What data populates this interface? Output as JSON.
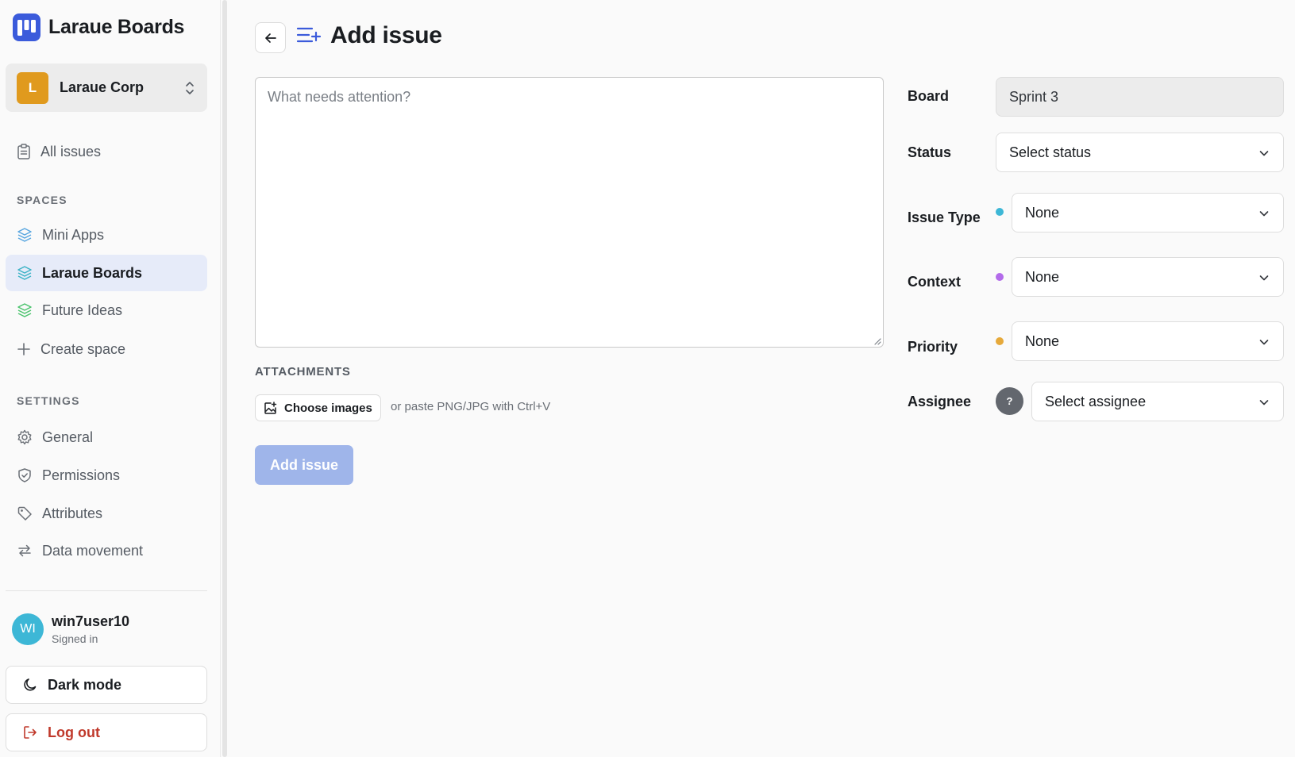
{
  "brand": {
    "title": "Laraue Boards",
    "color": "#3b5bdb"
  },
  "org": {
    "initial": "L",
    "name": "Laraue Corp",
    "color": "#e09a1e"
  },
  "nav": {
    "all_issues": "All issues"
  },
  "spaces": {
    "label": "SPACES",
    "items": [
      {
        "label": "Mini Apps",
        "icon": "layers-icon",
        "color": "#5aa7e0"
      },
      {
        "label": "Laraue Boards",
        "icon": "layers-icon",
        "color": "#3cb3c6",
        "active": true
      },
      {
        "label": "Future Ideas",
        "icon": "layers-icon",
        "color": "#4cc46e"
      }
    ],
    "create_label": "Create space"
  },
  "settings": {
    "label": "SETTINGS",
    "items": [
      {
        "label": "General",
        "icon": "gear-icon"
      },
      {
        "label": "Permissions",
        "icon": "shield-icon"
      },
      {
        "label": "Attributes",
        "icon": "tag-icon"
      },
      {
        "label": "Data movement",
        "icon": "arrows-swap-icon"
      }
    ]
  },
  "user": {
    "initials": "WI",
    "name": "win7user10",
    "status": "Signed in",
    "color": "#3db7d6"
  },
  "sidebar_actions": {
    "dark_mode": "Dark mode",
    "log_out": "Log out"
  },
  "page": {
    "title": "Add issue"
  },
  "form": {
    "description_placeholder": "What needs attention?",
    "description_value": "",
    "attachments_label": "ATTACHMENTS",
    "choose_images": "Choose images",
    "paste_hint": "or paste PNG/JPG with Ctrl+V",
    "submit": "Add issue",
    "submit_color": "#9fb5ea"
  },
  "fields": {
    "board": {
      "label": "Board",
      "value": "Sprint 3"
    },
    "status": {
      "label": "Status",
      "value": "Select status"
    },
    "issue_type": {
      "label": "Issue Type",
      "value": "None",
      "dot_color": "#3db7d6"
    },
    "context": {
      "label": "Context",
      "value": "None",
      "dot_color": "#b36bea"
    },
    "priority": {
      "label": "Priority",
      "value": "None",
      "dot_color": "#e6a93a"
    },
    "assignee": {
      "label": "Assignee",
      "value": "Select assignee",
      "avatar_text": "?"
    }
  }
}
